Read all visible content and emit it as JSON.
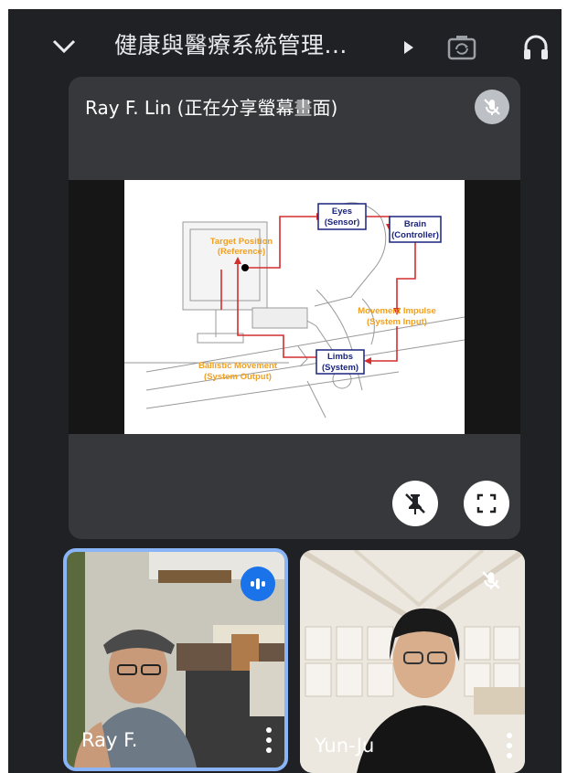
{
  "header": {
    "title": "健康與醫療系統管理...",
    "icons": [
      "chevron-down-icon",
      "play-arrow-icon",
      "switch-camera-icon",
      "headphones-icon"
    ]
  },
  "presentation": {
    "presenter_label": "Ray F. Lin (正在分享螢幕畫面)",
    "slide": {
      "eyes": "Eyes",
      "sensor": "(Sensor)",
      "brain": "Brain",
      "controller": "(Controller)",
      "target": "Target Position",
      "reference": "(Reference)",
      "movement_impulse": "Movement Impulse",
      "system_input": "(System Input)",
      "limbs": "Limbs",
      "system": "(System)",
      "ballistic": "Ballistic Movement",
      "system_output": "(System Output)"
    }
  },
  "participants": [
    {
      "name": "Ray F.",
      "speaking": true
    },
    {
      "name": "Yun-Ju",
      "muted": true
    }
  ],
  "colors": {
    "background": "#202124",
    "accent": "#8ab4f8",
    "speaking": "#1a73e8",
    "arrow": "#d32f2f",
    "label_orange": "#f0a020",
    "label_blue": "#1a237e"
  }
}
